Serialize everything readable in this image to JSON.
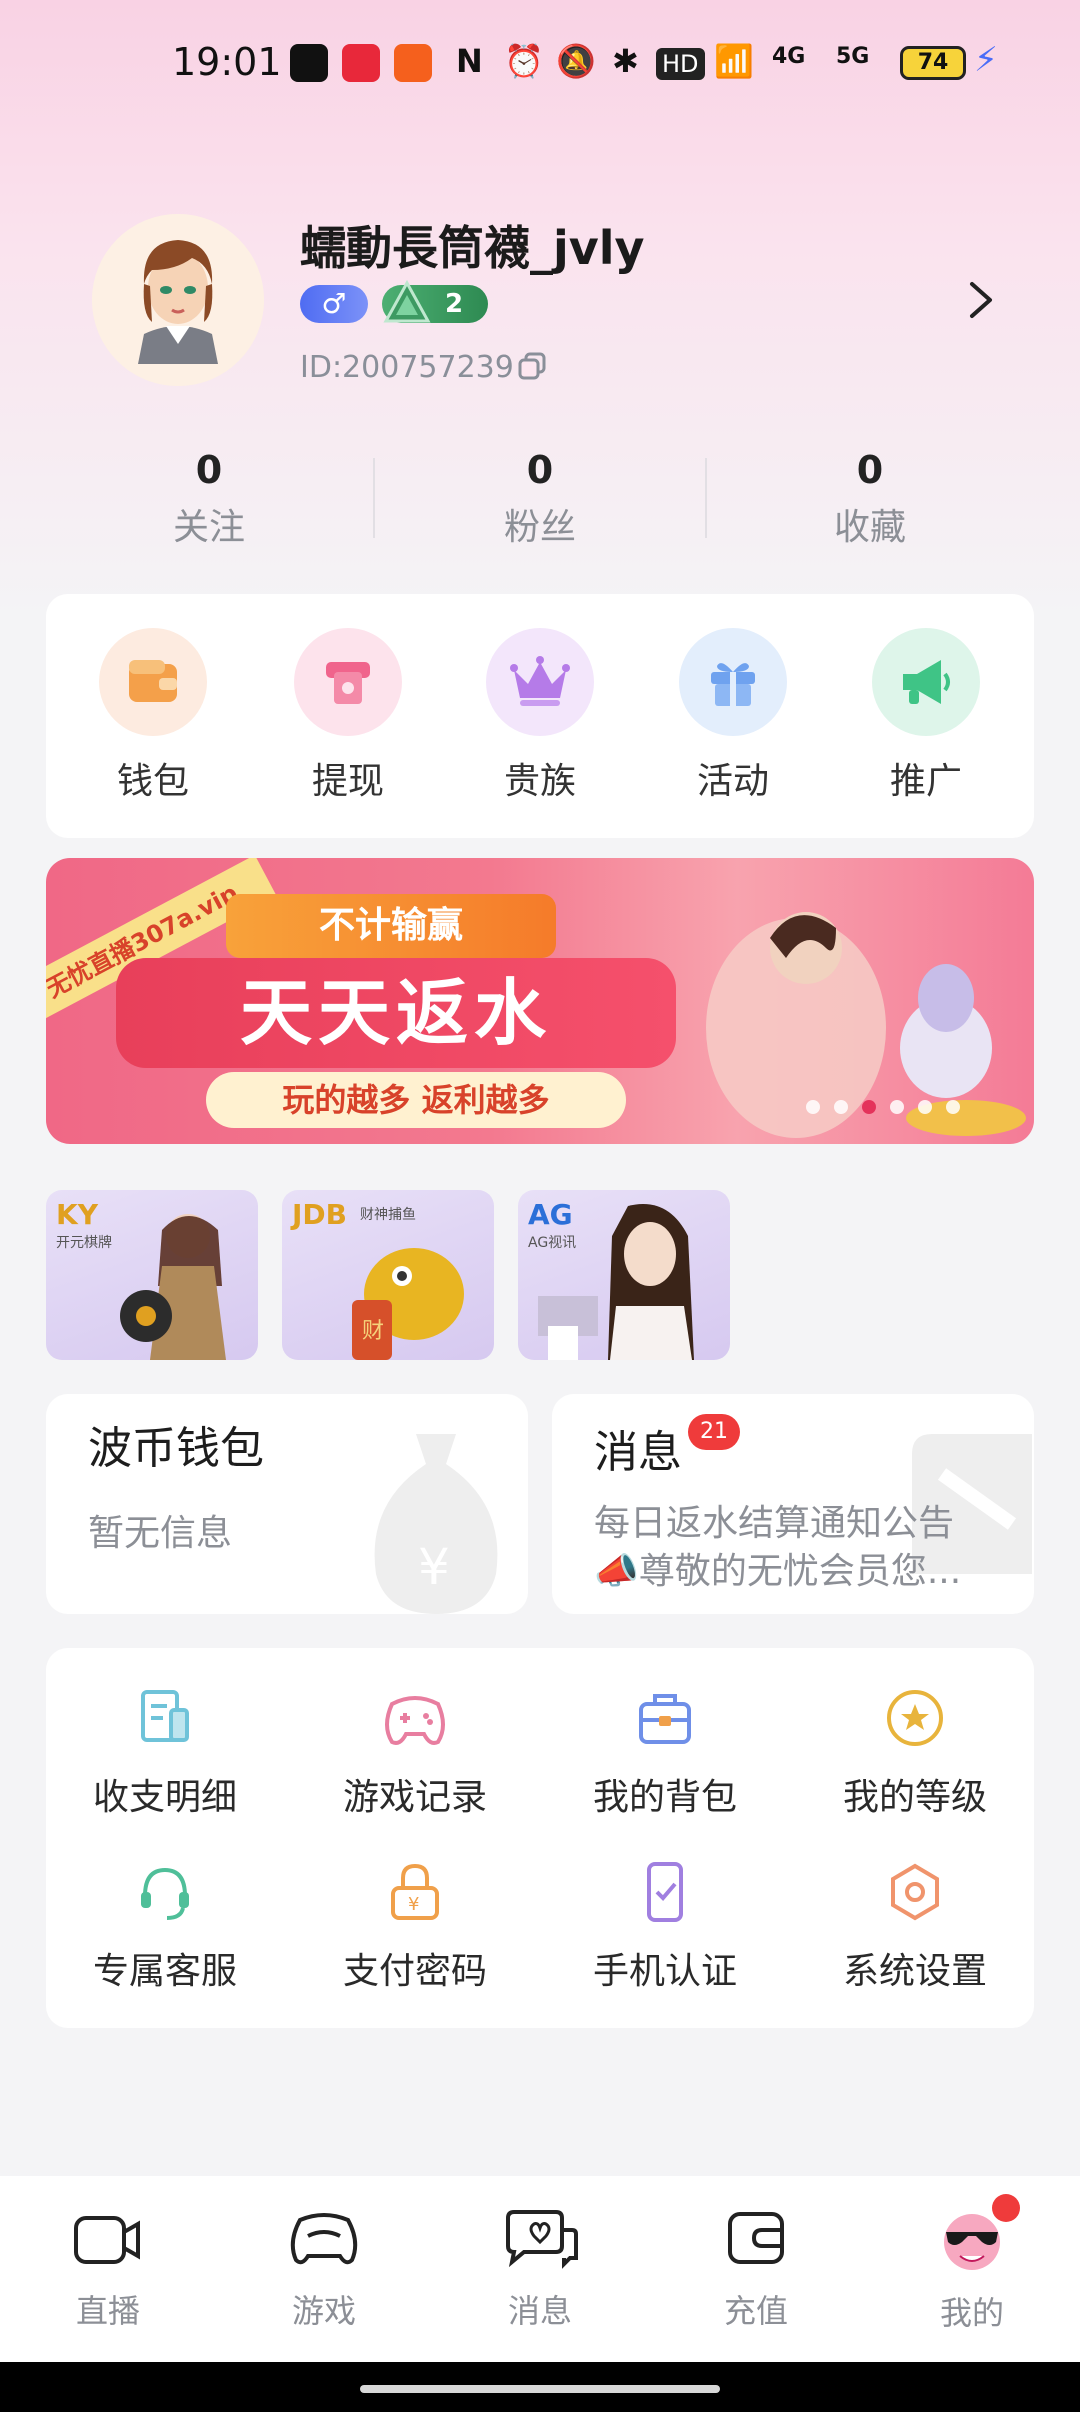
{
  "status_bar": {
    "time": "19:01",
    "battery": "74",
    "network_1": "4G",
    "network_2": "5G"
  },
  "profile": {
    "nickname": "蠕動長筒襪_jvly",
    "gender_symbol": "♂",
    "level": "2",
    "user_id": "ID:200757239"
  },
  "stats": [
    {
      "value": "0",
      "label": "关注"
    },
    {
      "value": "0",
      "label": "粉丝"
    },
    {
      "value": "0",
      "label": "收藏"
    }
  ],
  "quick_actions": [
    {
      "label": "钱包",
      "icon": "wallet-icon",
      "bg": "#fdebe0",
      "color": "#f4a04a"
    },
    {
      "label": "提现",
      "icon": "withdraw-icon",
      "bg": "#fde3ec",
      "color": "#f0648c"
    },
    {
      "label": "贵族",
      "icon": "crown-icon",
      "bg": "#f3e6fb",
      "color": "#b57be8"
    },
    {
      "label": "活动",
      "icon": "gift-icon",
      "bg": "#e3eefc",
      "color": "#6fa2ef"
    },
    {
      "label": "推广",
      "icon": "megaphone-icon",
      "bg": "#def5ea",
      "color": "#3fc486"
    }
  ],
  "banner": {
    "ribbon": "无忧直播307a.vip",
    "tag": "不计输赢",
    "headline": "天天返水",
    "subline": "玩的越多 返利越多"
  },
  "game_tiles": [
    {
      "brand": "KY",
      "sub": "开元棋牌",
      "color": "#e0a020"
    },
    {
      "brand": "JDB",
      "sub": "财神捕鱼",
      "color": "#e0a020"
    },
    {
      "brand": "AG",
      "sub": "AG视讯",
      "color": "#2b6fd8"
    }
  ],
  "wallet_card": {
    "title": "波币钱包",
    "text": "暂无信息"
  },
  "message_card": {
    "title": "消息",
    "badge": "21",
    "line1": "每日返水结算通知公告",
    "line2": "📣尊敬的无忧会员您..."
  },
  "services": [
    {
      "label": "收支明细",
      "icon": "ledger-icon",
      "color": "#6fc3d9"
    },
    {
      "label": "游戏记录",
      "icon": "gamepad-icon",
      "color": "#e87ea0"
    },
    {
      "label": "我的背包",
      "icon": "backpack-icon",
      "color": "#6f8fe8"
    },
    {
      "label": "我的等级",
      "icon": "star-badge-icon",
      "color": "#e8b43c"
    },
    {
      "label": "专属客服",
      "icon": "headset-icon",
      "color": "#4fbf99"
    },
    {
      "label": "支付密码",
      "icon": "lock-icon",
      "color": "#f0a04a"
    },
    {
      "label": "手机认证",
      "icon": "phone-check-icon",
      "color": "#a07fe0"
    },
    {
      "label": "系统设置",
      "icon": "settings-hex-icon",
      "color": "#f0946c"
    }
  ],
  "bottom_nav": [
    {
      "label": "直播",
      "icon": "camera-icon"
    },
    {
      "label": "游戏",
      "icon": "controller-icon"
    },
    {
      "label": "消息",
      "icon": "chat-heart-icon"
    },
    {
      "label": "充值",
      "icon": "wallet-nav-icon"
    },
    {
      "label": "我的",
      "icon": "avatar-nav-icon"
    }
  ]
}
